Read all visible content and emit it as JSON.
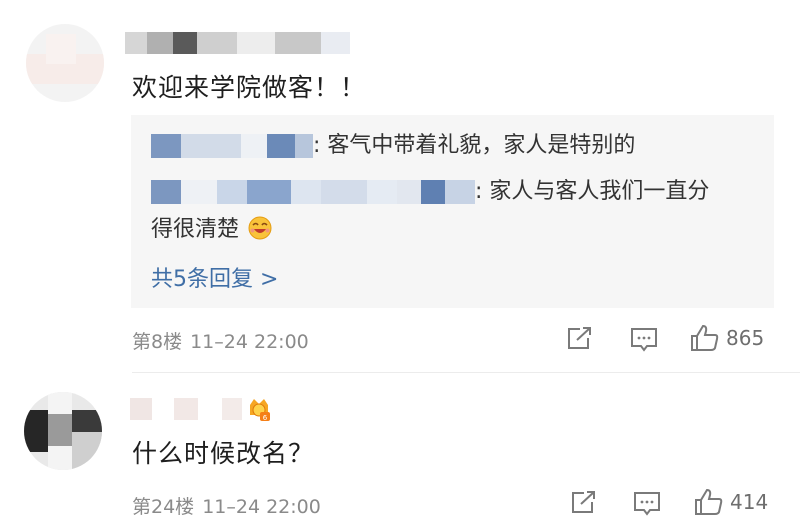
{
  "comments": [
    {
      "username": "",
      "content": "欢迎来学院做客！！",
      "replies": [
        {
          "text": ": 客气中带着礼貌，家人是特别的"
        },
        {
          "text_line1": ": 家人与客人我们一直分",
          "text_line2": "得很清楚"
        }
      ],
      "more_replies": "共5条回复 >",
      "floor": "第8楼",
      "time": "11–24 22:00",
      "likes": "865"
    },
    {
      "username": "",
      "content": "什么时候改名？",
      "floor": "第24楼",
      "time": "11–24 22:00",
      "likes": "414"
    }
  ],
  "colors": {
    "link": "#3f6ea6",
    "meta": "#8a8a8a",
    "reply_bg": "#f6f6f6"
  },
  "icons": [
    "share-icon",
    "comment-icon",
    "thumb-up-icon",
    "emoji-laugh-icon",
    "vip-badge-icon"
  ]
}
